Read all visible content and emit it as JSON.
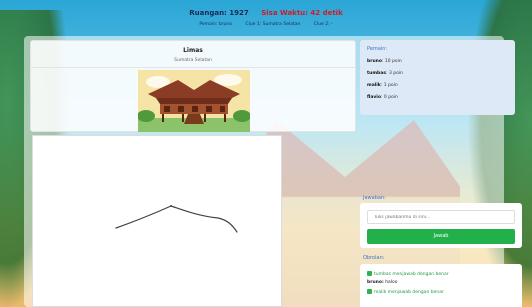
{
  "header": {
    "room_label": "Ruangan: 1927",
    "time_label": "Sisa Waktu: 42 detik",
    "player_label": "Pemain: bruno",
    "clue1_label": "Clue 1: Sumatra Selatan",
    "clue2_label": "Clue 2: -"
  },
  "clue_card": {
    "title": "Limas",
    "subtitle": "Sumatra Selatan"
  },
  "players": {
    "heading": "Pemain:",
    "list": [
      {
        "name": "bruno",
        "points": "10 poin"
      },
      {
        "name": "tumbas",
        "points": "3 poin"
      },
      {
        "name": "malik",
        "points": "1 poin"
      },
      {
        "name": "flavio",
        "points": "0 poin"
      }
    ]
  },
  "answer": {
    "heading": "Jawaban:",
    "placeholder": "Tulis jawabanmu di sini...",
    "button_label": "Jawab"
  },
  "chat": {
    "heading": "Obrolan:",
    "messages": [
      {
        "type": "system",
        "text": "tumbas menjawab dengan benar"
      },
      {
        "type": "user",
        "user": "bruno:",
        "text": "haloo"
      },
      {
        "type": "system",
        "text": "malik menjawab dengan benar"
      }
    ]
  },
  "colors": {
    "accent": "#3a76c4",
    "time": "#d11a2a",
    "button": "#22b04b"
  }
}
